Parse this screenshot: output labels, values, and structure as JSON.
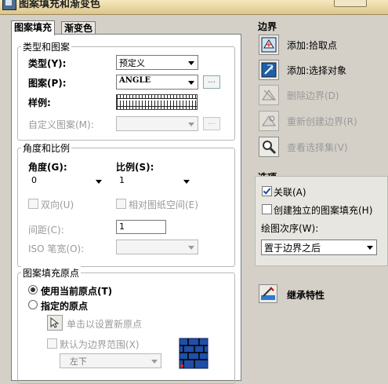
{
  "window": {
    "title": "图案填充和渐变色"
  },
  "tabs": [
    {
      "label": "图案填充",
      "active": true
    },
    {
      "label": "渐变色",
      "active": false
    }
  ],
  "type_pattern": {
    "legend": "类型和图案",
    "type_label": "类型(Y):",
    "type_value": "预定义",
    "pattern_label": "图案(P):",
    "pattern_value": "ANGLE",
    "sample_label": "样例:",
    "custom_label": "自定义图案(M):",
    "custom_value": ""
  },
  "angle_scale": {
    "legend": "角度和比例",
    "angle_label": "角度(G):",
    "angle_value": "0",
    "scale_label": "比例(S):",
    "scale_value": "1",
    "double_label": "双向(U)",
    "relative_label": "相对图纸空间(E)",
    "spacing_label": "间距(C):",
    "spacing_value": "1",
    "iso_label": "ISO 笔宽(O):",
    "iso_value": ""
  },
  "origin": {
    "legend": "图案填充原点",
    "use_current_label": "使用当前原点(T)",
    "specified_label": "指定的原点",
    "click_set_label": "单击以设置新原点",
    "default_extents_label": "默认为边界范围(X)",
    "position_value": "左下"
  },
  "boundary": {
    "heading": "边界",
    "add_pick": "添加:拾取点",
    "add_select": "添加:选择对象",
    "remove": "删除边界(D)",
    "recreate": "重新创建边界(R)",
    "view_selection": "查看选择集(V)"
  },
  "options": {
    "heading": "选项",
    "associative_label": "关联(A)",
    "independent_label": "创建独立的图案填充(H)",
    "draw_order_label": "绘图次序(W):",
    "draw_order_value": "置于边界之后"
  },
  "inherit": {
    "label": "继承特性"
  },
  "colors": {
    "accent": "#1a4ca0",
    "panel": "#ffffff",
    "dialog": "#d4d0c8"
  }
}
